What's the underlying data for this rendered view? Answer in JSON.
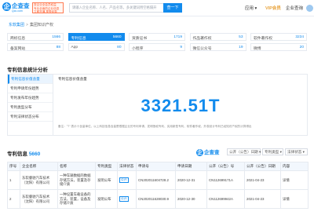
{
  "header": {
    "logo_glyph": "企",
    "logo_name": "企查查",
    "logo_sub": "Qcc.com",
    "promo_lines": [
      "查企业全会员权益",
      "专业全面的企业信息",
      "立即开通 享受优惠"
    ],
    "search_placeholder": "请输入企业名称、人名、产品名等，多关键词用空格隔开",
    "search_button": "查一下",
    "nav": {
      "app": "应用 ▾",
      "vip": "VIP会员",
      "center": "企业查询"
    }
  },
  "breadcrumb": {
    "company": "东软集团",
    "separator": ">",
    "current": "集团知识产权"
  },
  "stats": [
    {
      "label": "商标信息",
      "value": "1566",
      "active": false
    },
    {
      "label": "专利信息",
      "value": "5660",
      "active": true
    },
    {
      "label": "资质证书",
      "value": "1719",
      "active": false
    },
    {
      "label": "作品著作权",
      "value": "53",
      "active": false
    },
    {
      "label": "软件著作权",
      "value": "3234",
      "active": false
    },
    {
      "label": "备案网站",
      "value": "88",
      "active": false
    },
    {
      "label": "App",
      "value": "80",
      "active": false
    },
    {
      "label": "小程序",
      "value": "9",
      "active": false
    },
    {
      "label": "微信公众号",
      "value": "19",
      "active": false
    },
    {
      "label": "微博",
      "value": "20",
      "active": false
    }
  ],
  "analysis": {
    "title": "专利信息统计分析",
    "side_items": [
      {
        "label": "专利信息价值含量",
        "active": true
      },
      {
        "label": "专利申请年份趋势",
        "active": false
      },
      {
        "label": "专利发布年份趋势",
        "active": false
      },
      {
        "label": "专利类型分布",
        "active": false
      },
      {
        "label": "专利法律状态分布",
        "active": false
      }
    ],
    "chart_title": "专利信息价值含量",
    "chart_value": "3321.51T",
    "note": "备注：\"T\" 表示十含量单位，以上科技信息含量是根据企业的专利申请、发明授权专利、实用新型专利、软件著作权、外观设计专利已经知识产权的计算得出"
  },
  "patent_list": {
    "title": "专利信息",
    "count": "5660",
    "brand_glyph": "企",
    "brand_name": "企查查",
    "filters": [
      "公开（公告）日期 ▾",
      "专利类型 ▾",
      "法律状态 ▾"
    ],
    "columns": [
      "序号",
      "企业名称",
      "名称",
      "专利类型",
      "法律状态",
      "申请号",
      "申请日期",
      "公开（公告）号",
      "公开（公告）日期",
      "内容"
    ],
    "rows": [
      {
        "no": "1",
        "company": "东软睿驰汽车技术（沈阳）有限公司",
        "name": "一种车辆数据的数据存储方法，装置及存储介质",
        "type": "发明公布",
        "status": "公开",
        "app_no": "CN202011604728.2",
        "app_date": "2020-12-31",
        "pub_no": "CN112699171A",
        "pub_date": "2021-04-23",
        "action": "详情"
      },
      {
        "no": "2",
        "company": "东软睿驰汽车技术（沈阳）有限公司",
        "name": "一种设置车载设备的方法，装置，设备及存储介质",
        "type": "发明公布",
        "status": "公开",
        "app_no": "CN202011628030.9",
        "app_date": "2020-12-30",
        "pub_no": "CN112699942A",
        "pub_date": "2021-04-23",
        "action": "详情"
      }
    ]
  }
}
